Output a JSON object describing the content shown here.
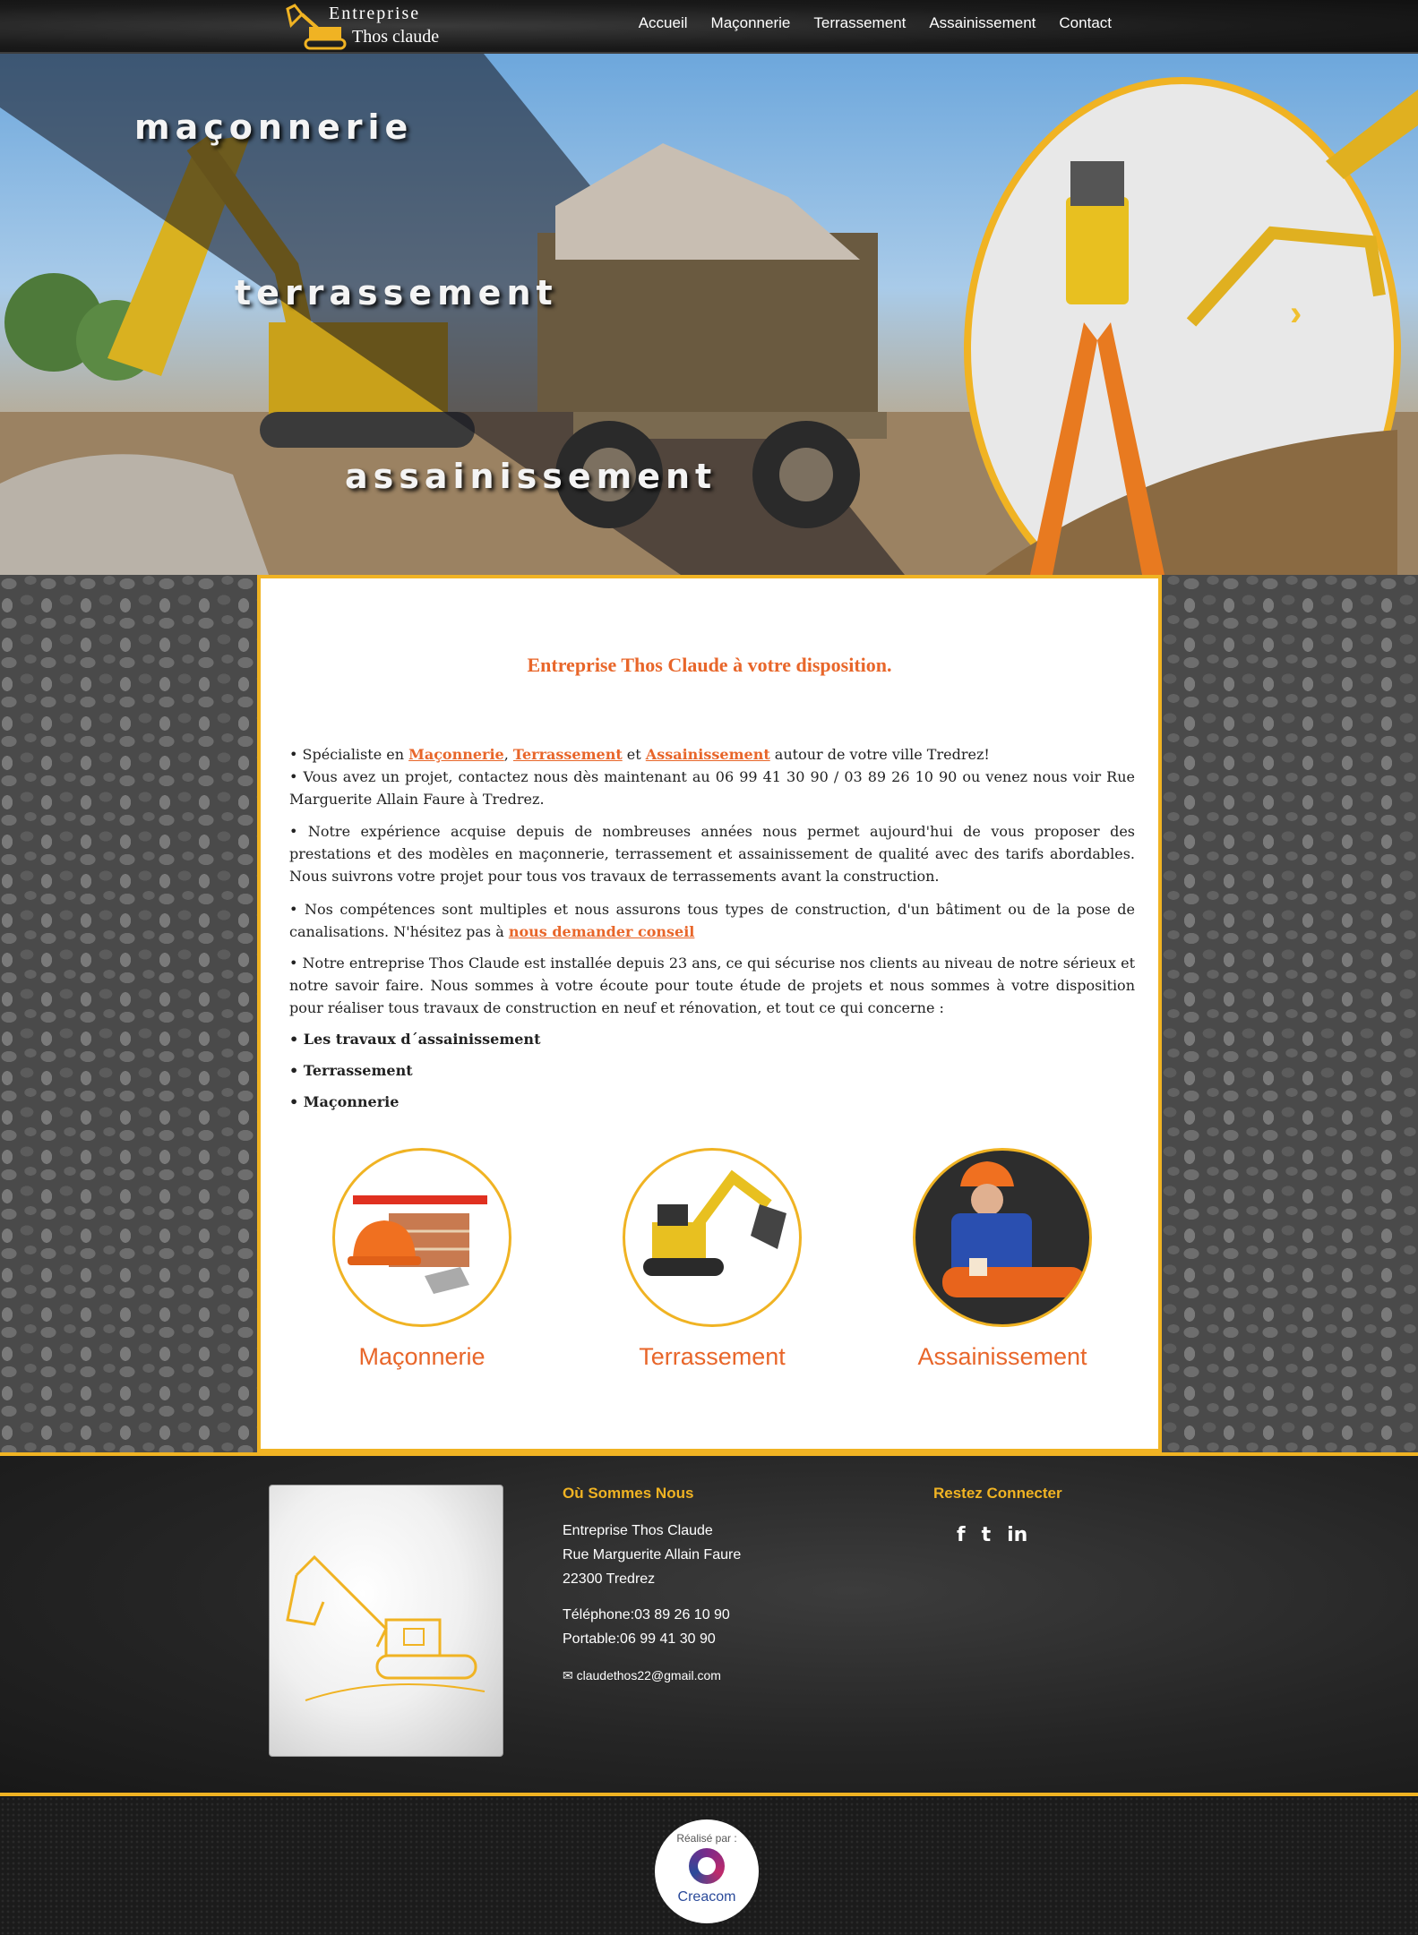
{
  "brand": {
    "line1": "Entreprise",
    "line2": "Thos claude"
  },
  "nav": {
    "items": [
      "Accueil",
      "Maçonnerie",
      "Terrassement",
      "Assainissement",
      "Contact"
    ]
  },
  "hero": {
    "words": [
      "maçonnerie",
      "terrassement",
      "assainissement"
    ],
    "next_arrow": "›"
  },
  "content": {
    "title": "Entreprise Thos Claude à votre disposition.",
    "intro_prefix": "• Spécialiste en ",
    "link_maconnerie": "Maçonnerie",
    "sep1": ", ",
    "link_terrassement": "Terrassement",
    "sep2": "  et ",
    "link_assainissement": "Assainissement",
    "intro_suffix": " autour de votre ville Tredrez!",
    "contact_line": "• Vous avez un projet, contactez nous dès maintenant au 06 99 41 30 90 / 03 89 26 10 90 ou venez nous voir Rue Marguerite Allain Faure à Tredrez.",
    "experience": "• Notre expérience acquise depuis de nombreuses années nous permet aujourd'hui de vous proposer des prestations  et des modèles en maçonnerie, terrassement et assainissement de qualité avec des tarifs abordables. Nous suivrons votre projet pour tous vos travaux de terrassements avant la construction.",
    "competences_prefix": "• Nos compétences sont multiples et nous assurons tous types de construction, d'un bâtiment ou de la pose de canalisations. N'hésitez pas à ",
    "conseil_link": "nous demander conseil",
    "installed": "• Notre entreprise Thos Claude est installée depuis 23 ans, ce qui sécurise nos clients au niveau de notre sérieux et notre savoir faire. Nous sommes à votre écoute pour toute étude de projets et nous sommes à votre disposition pour réaliser tous travaux de construction en neuf et rénovation, et tout ce qui concerne :",
    "bullets": [
      "• Les travaux d´assainissement",
      "• Terrassement",
      "• Maçonnerie"
    ]
  },
  "services": [
    {
      "label": "Maçonnerie",
      "icon": "masonry-tools-icon"
    },
    {
      "label": "Terrassement",
      "icon": "excavator-icon"
    },
    {
      "label": "Assainissement",
      "icon": "worker-pipe-icon"
    }
  ],
  "footer": {
    "where_title": "Où Sommes Nous",
    "company": "Entreprise Thos Claude",
    "street": "Rue Marguerite Allain Faure",
    "city": "22300  Tredrez",
    "phone": "Téléphone:03 89 26 10 90",
    "mobile": "Portable:06 99 41 30 90",
    "email": "claudethos22@gmail.com",
    "social_title": "Restez Connecter",
    "social": [
      "f",
      "t",
      "in"
    ]
  },
  "credits": {
    "made_by": "Réalisé par :",
    "agency": "Creacom"
  },
  "colors": {
    "accent_orange": "#e8662a",
    "accent_yellow": "#f0b323"
  }
}
